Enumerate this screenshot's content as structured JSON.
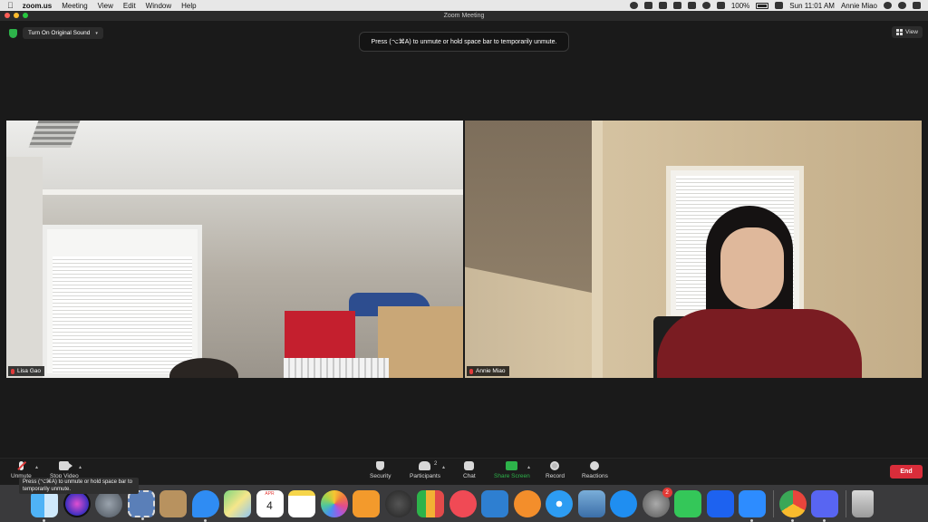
{
  "menubar": {
    "app_name": "zoom.us",
    "menus": [
      "Meeting",
      "View",
      "Edit",
      "Window",
      "Help"
    ],
    "battery": "100%",
    "datetime": "Sun 11:01 AM",
    "user": "Annie Miao"
  },
  "window": {
    "title": "Zoom Meeting"
  },
  "meeting": {
    "original_sound_label": "Turn On Original Sound",
    "top_tooltip": "Press  (⌥⌘A) to unmute or hold space bar to temporarily unmute.",
    "view_label": "View"
  },
  "participants": [
    {
      "name": "Lisa Gao",
      "muted": true
    },
    {
      "name": "Annie Miao",
      "muted": true
    }
  ],
  "toolbar": {
    "unmute_label": "Unmute",
    "stop_video_label": "Stop Video",
    "security_label": "Security",
    "participants_label": "Participants",
    "participants_count": "2",
    "chat_label": "Chat",
    "share_screen_label": "Share Screen",
    "record_label": "Record",
    "reactions_label": "Reactions",
    "end_label": "End",
    "bottom_tooltip": "Press  (⌥⌘A) to unmute or hold space bar to temporarily unmute."
  },
  "dock": {
    "calendar_month": "APR",
    "calendar_day": "4",
    "system_prefs_badge": "2",
    "apps": [
      "finder",
      "siri",
      "launchpad",
      "mail-stamp",
      "contacts",
      "messages",
      "maps",
      "calendar",
      "notes",
      "photos",
      "pages",
      "dashboard",
      "numbers",
      "news",
      "keynote",
      "books",
      "safari",
      "preview",
      "app-store",
      "system-preferences",
      "facetime",
      "dropbox",
      "zoom",
      "chrome",
      "discord",
      "trash"
    ]
  },
  "colors": {
    "accent_green": "#2db34a",
    "end_red": "#d92d3a",
    "muted_red": "#e03a3a"
  }
}
